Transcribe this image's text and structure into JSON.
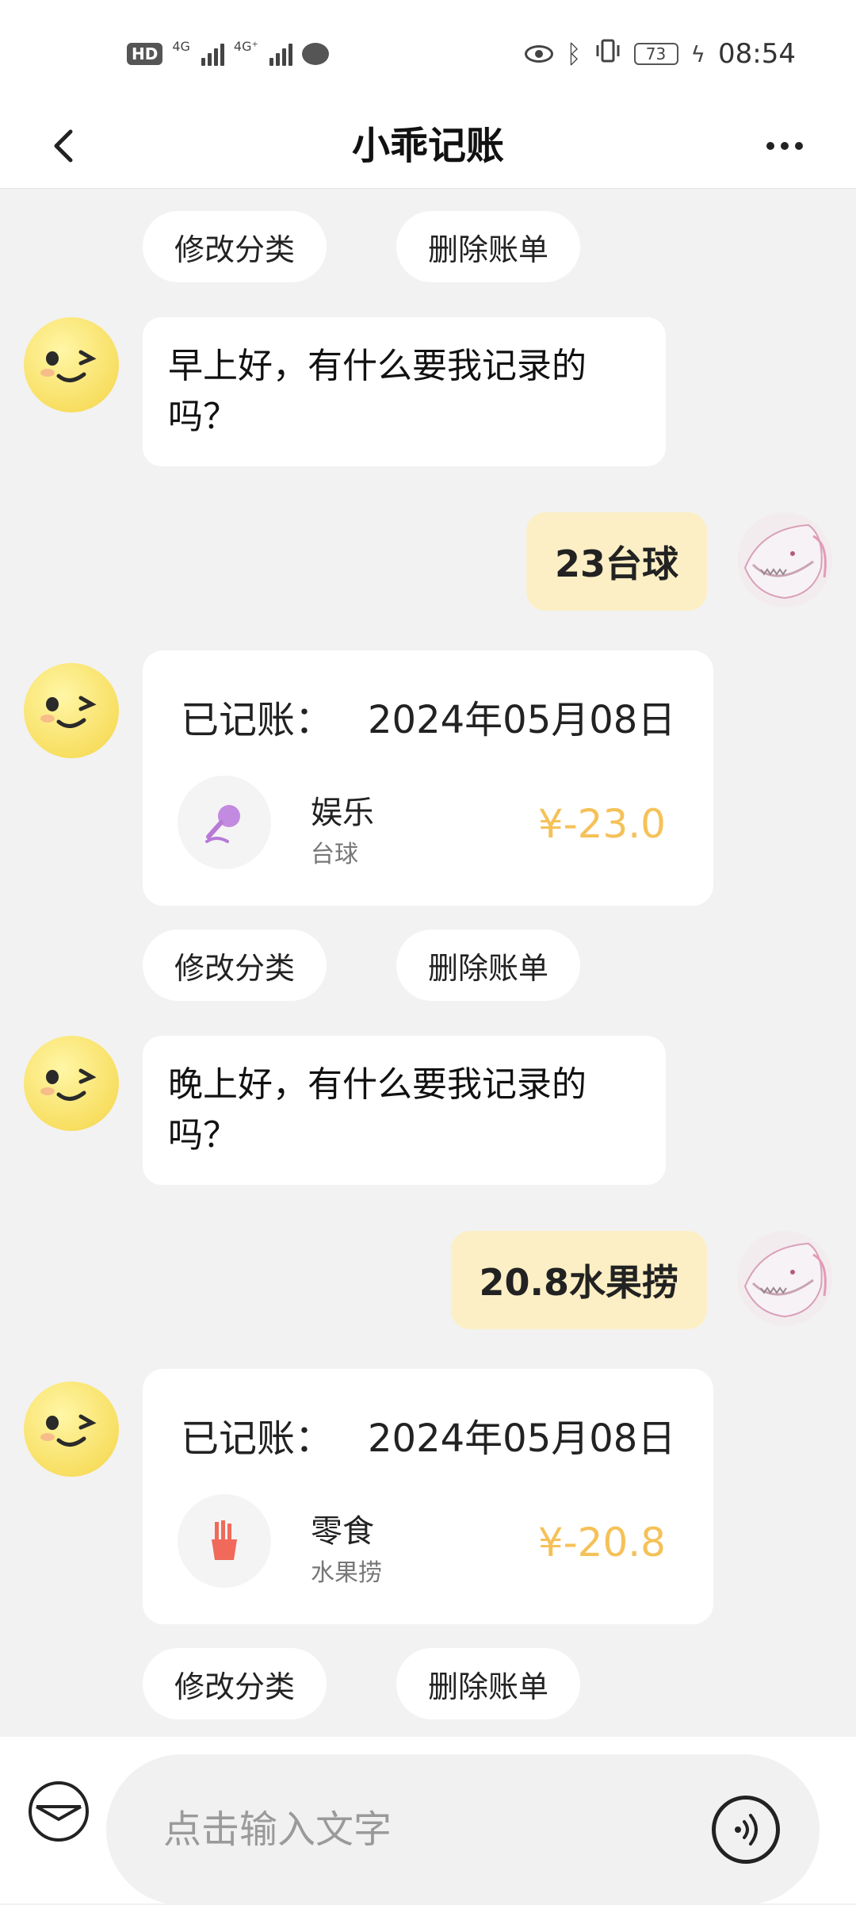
{
  "status_bar": {
    "left_badge": "HD",
    "network_1": "4G",
    "network_2": "4G⁺",
    "battery": "73",
    "time": "08:54"
  },
  "header": {
    "title": "小乖记账"
  },
  "actions": {
    "modify_category": "修改分类",
    "delete_bill": "删除账单"
  },
  "messages": {
    "greeting_morning": "早上好，有什么要我记录的吗？",
    "user_msg_1": "23台球",
    "record_1": {
      "label": "已记账：",
      "date": "2024年05月08日",
      "category": "娱乐",
      "note": "台球",
      "amount": "¥-23.0",
      "icon": "microphone-icon"
    },
    "greeting_evening": "晚上好，有什么要我记录的吗？",
    "user_msg_2": "20.8水果捞",
    "record_2": {
      "label": "已记账：",
      "date": "2024年05月08日",
      "category": "零食",
      "note": "水果捞",
      "amount": "¥-20.8",
      "icon": "fries-icon"
    }
  },
  "input": {
    "placeholder": "点击输入文字"
  },
  "colors": {
    "accent_amount": "#f5c158",
    "user_bubble": "#fcefc5",
    "background": "#f2f2f2",
    "entertainment_icon": "#b87ad6",
    "snack_icon": "#f06a5a"
  }
}
